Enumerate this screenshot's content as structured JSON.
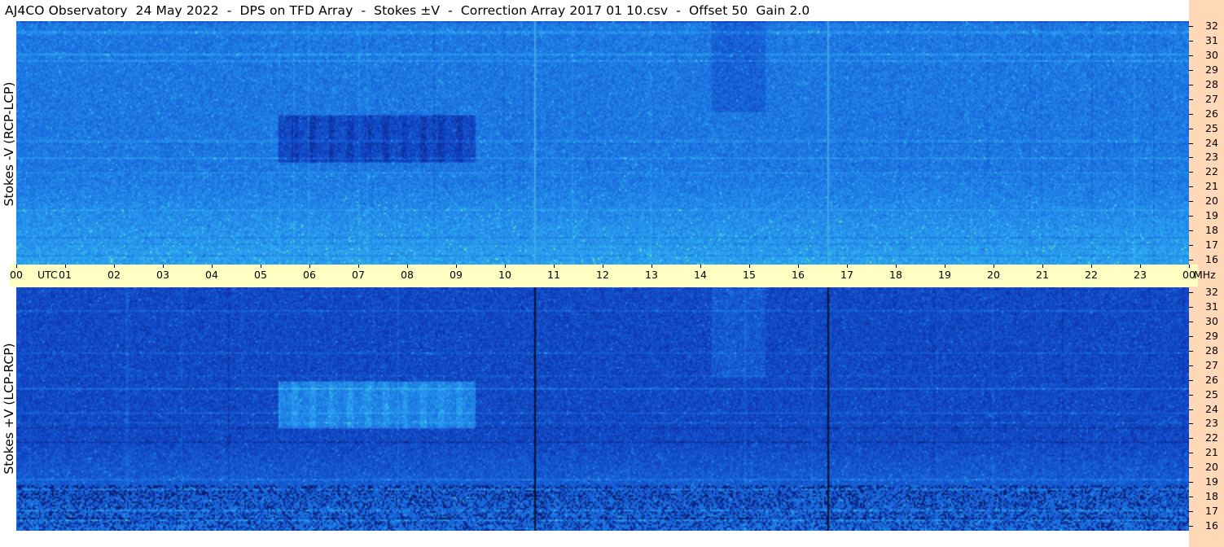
{
  "title": "AJ4CO Observatory  24 May 2022  -  DPS on TFD Array  -  Stokes ±V  -  Correction Array 2017 01 10.csv  -  Offset 50  Gain 2.0",
  "chart_data": {
    "type": "heatmap",
    "title": "AJ4CO Observatory  24 May 2022  -  DPS on TFD Array  -  Stokes ±V  -  Correction Array 2017 01 10.csv  -  Offset 50  Gain 2.0",
    "x_axis": {
      "unit": "UTC",
      "range": [
        0,
        24
      ],
      "tick_labels": [
        "00",
        "01",
        "02",
        "03",
        "04",
        "05",
        "06",
        "07",
        "08",
        "09",
        "10",
        "11",
        "12",
        "13",
        "14",
        "15",
        "16",
        "17",
        "18",
        "19",
        "20",
        "21",
        "22",
        "23",
        "00"
      ]
    },
    "y_axis": {
      "unit": "MHz",
      "range": [
        16,
        32
      ],
      "tick_labels": [
        "16",
        "17",
        "18",
        "19",
        "20",
        "21",
        "22",
        "23",
        "24",
        "25",
        "26",
        "27",
        "28",
        "29",
        "30",
        "31",
        "32"
      ]
    },
    "panels": [
      {
        "name": "top",
        "ylabel": "Stokes -V (RCP-LCP)",
        "colormap": [
          "#0a1a6a",
          "#1040c0",
          "#1a6fe0",
          "#2aa0f0",
          "#40d0e8",
          "#a0f070",
          "#ffff40"
        ]
      },
      {
        "name": "bottom",
        "ylabel": "Stokes +V (LCP-RCP)",
        "colormap": [
          "#000018",
          "#0a1a6a",
          "#1040c0",
          "#1a6fe0",
          "#2aa0f0",
          "#40d0e8",
          "#a0f070"
        ]
      }
    ],
    "vertical_markers_utc": [
      10.6,
      16.6
    ]
  },
  "colors": {
    "time_axis_bg": "#ffffc4",
    "freq_axis_bg": "#ffd8b8"
  }
}
